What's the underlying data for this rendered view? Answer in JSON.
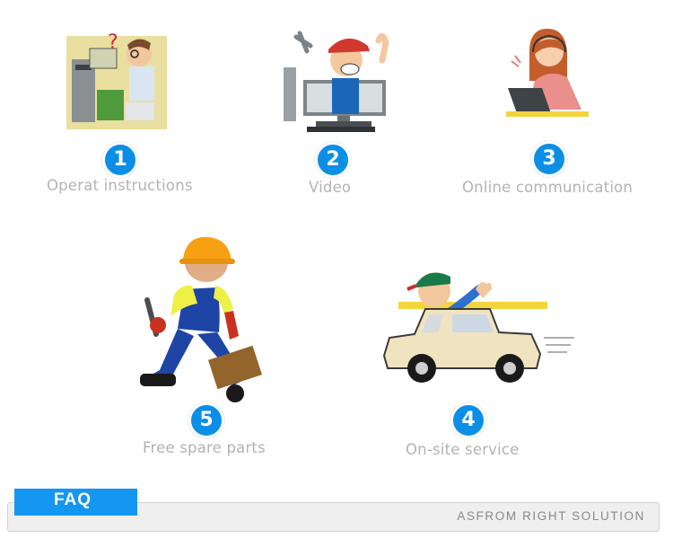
{
  "services": [
    {
      "number": "1",
      "label": "Operat instructions",
      "icon": "engineer-at-desk-icon"
    },
    {
      "number": "2",
      "label": "Video",
      "icon": "technician-on-monitor-icon"
    },
    {
      "number": "3",
      "label": "Online communication",
      "icon": "support-agent-headset-icon"
    },
    {
      "number": "5",
      "label": "Free spare parts",
      "icon": "worker-with-toolbox-icon"
    },
    {
      "number": "4",
      "label": "On-site service",
      "icon": "mechanic-in-car-icon"
    }
  ],
  "faq": {
    "tab_label": "FAQ",
    "slogan": "ASFROM RIGHT SOLUTION"
  },
  "colors": {
    "badge": "#0b8fe6",
    "faq_tab": "#1596f0",
    "label_text": "#b3b3b3",
    "bar": "#efefef"
  }
}
